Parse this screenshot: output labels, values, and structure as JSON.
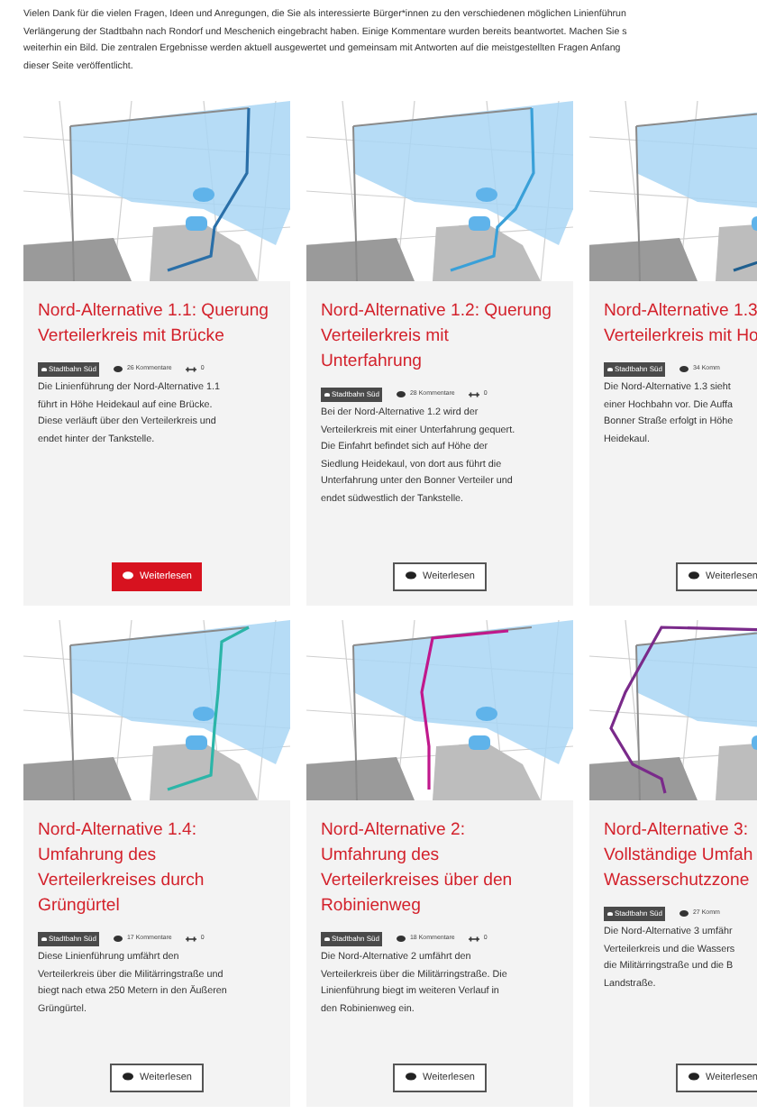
{
  "intro_lines": [
    "Vielen Dank für die vielen Fragen, Ideen und Anregungen, die Sie als interessierte Bürger*innen zu den verschiedenen möglichen Linienführun",
    "Verlängerung der Stadtbahn nach Rondorf und Meschenich eingebracht haben. Einige Kommentare wurden bereits beantwortet. Machen Sie s",
    "weiterhin ein Bild. Die zentralen Ergebnisse werden aktuell ausgewertet und gemeinsam mit Antworten auf die meistgestellten Fragen Anfang",
    "dieser Seite veröffentlicht."
  ],
  "cards": [
    {
      "color": "#2a6fa8",
      "title_lines": [
        "Nord-Alternative 1.1: Querung",
        "Verteilerkreis mit Brücke"
      ],
      "tag": "Stadtbahn Süd",
      "comments": "26 Kommentare",
      "likes": "0",
      "description_lines": [
        "Die Linienführung der Nord-Alternative 1.1",
        "führt in Höhe Heidekaul auf eine Brücke.",
        "Diese verläuft über den Verteilerkreis und",
        "endet hinter der Tankstelle."
      ],
      "button": "Weiterlesen",
      "highlighted": true
    },
    {
      "color": "#3aa0d8",
      "title_lines": [
        "Nord-Alternative 1.2: Querung",
        "Verteilerkreis mit",
        "Unterfahrung"
      ],
      "tag": "Stadtbahn Süd",
      "comments": "28 Kommentare",
      "likes": "0",
      "description_lines": [
        "Bei der Nord-Alternative 1.2 wird der",
        "Verteilerkreis mit einer Unterfahrung gequert.",
        "Die Einfahrt befindet sich auf Höhe der",
        "Siedlung Heidekaul, von dort aus führt die",
        "Unterfahrung unter den Bonner Verteiler und",
        "endet südwestlich der Tankstelle."
      ],
      "button": "Weiterlesen",
      "highlighted": false
    },
    {
      "color": "#1f5f8f",
      "title_lines": [
        "Nord-Alternative 1.3",
        "Verteilerkreis mit Ho"
      ],
      "tag": "Stadtbahn Süd",
      "comments": "34 Komm",
      "description_lines": [
        "Die Nord-Alternative 1.3 sieht",
        "einer Hochbahn vor. Die Auffa",
        "Bonner Straße erfolgt in Höhe",
        "Heidekaul."
      ],
      "button": "Weiterlesen",
      "highlighted": false
    },
    {
      "color": "#2bb5a8",
      "title_lines": [
        "Nord-Alternative 1.4:",
        "Umfahrung des",
        "Verteilerkreises durch",
        "Grüngürtel"
      ],
      "tag": "Stadtbahn Süd",
      "comments": "17 Kommentare",
      "likes": "0",
      "description_lines": [
        "Diese Linienführung umfährt den",
        "Verteilerkreis über die Militärringstraße und",
        "biegt nach etwa 250 Metern in den Äußeren",
        "Grüngürtel."
      ],
      "button": "Weiterlesen",
      "highlighted": false
    },
    {
      "color": "#c0188c",
      "title_lines": [
        "Nord-Alternative 2:",
        "Umfahrung des",
        "Verteilerkreises über den",
        "Robinienweg"
      ],
      "tag": "Stadtbahn Süd",
      "comments": "18 Kommentare",
      "likes": "0",
      "description_lines": [
        "Die Nord-Alternative 2 umfährt den",
        "Verteilerkreis über die Militärringstraße. Die",
        "Linienführung biegt im weiteren Verlauf in",
        "den Robinienweg ein."
      ],
      "button": "Weiterlesen",
      "highlighted": false
    },
    {
      "color": "#7a2a8a",
      "title_lines": [
        "Nord-Alternative 3:",
        "Vollständige Umfah",
        "Wasserschutzzone"
      ],
      "tag": "Stadtbahn Süd",
      "comments": "27 Komm",
      "description_lines": [
        "Die Nord-Alternative 3 umfähr",
        "Verteilerkreis und die Wassers",
        "die Militärringstraße und die B",
        "Landstraße."
      ],
      "button": "Weiterlesen",
      "highlighted": false
    }
  ]
}
